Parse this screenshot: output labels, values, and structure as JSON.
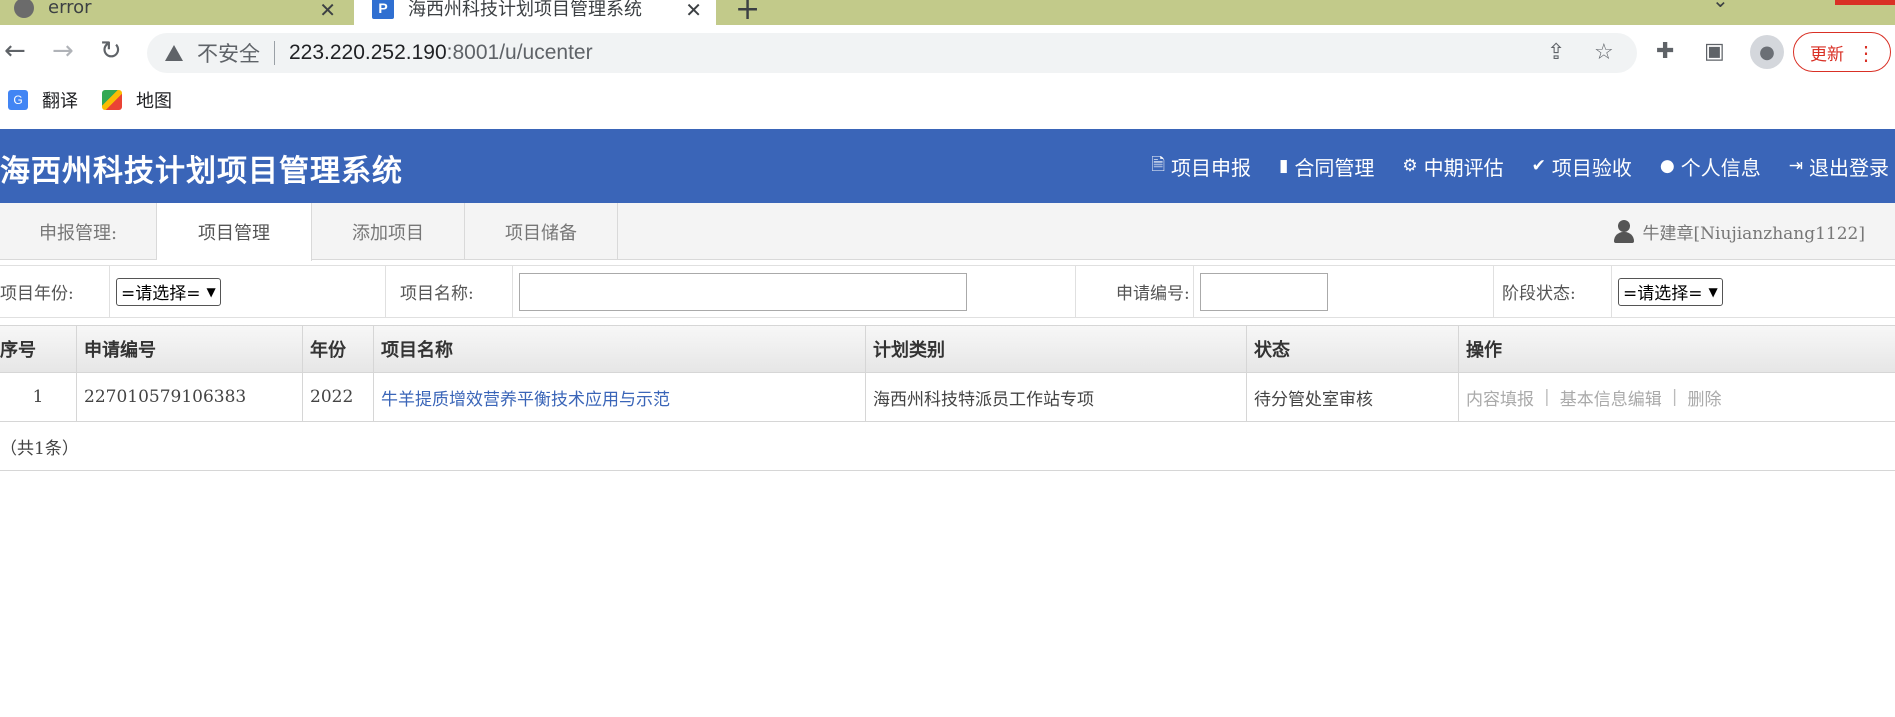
{
  "browser": {
    "tabs": [
      {
        "title": "error",
        "active": false
      },
      {
        "title": "海西州科技计划项目管理系统",
        "active": true
      }
    ],
    "address": {
      "security_label": "不安全",
      "host": "223.220.252.190",
      "path": ":8001/u/ucenter"
    },
    "update_label": "更新",
    "bookmarks": [
      {
        "label": "翻译",
        "icon": "translate-icon"
      },
      {
        "label": "地图",
        "icon": "maps-icon"
      }
    ]
  },
  "app": {
    "title": "海西州科技计划项目管理系统",
    "nav": [
      {
        "label": "项目申报",
        "icon": "word-doc-icon"
      },
      {
        "label": "合同管理",
        "icon": "file-icon"
      },
      {
        "label": "中期评估",
        "icon": "gears-icon"
      },
      {
        "label": "项目验收",
        "icon": "check-circle-icon"
      },
      {
        "label": "个人信息",
        "icon": "user-icon"
      },
      {
        "label": "退出登录",
        "icon": "sign-out-icon"
      }
    ],
    "colors": {
      "header_bg": "#3a65b8",
      "link": "#3a65b8"
    }
  },
  "subnav": {
    "label": "申报管理:",
    "tabs": [
      "项目管理",
      "添加项目",
      "项目储备"
    ],
    "active_tab": "项目管理",
    "user": "牛建章[Niujianzhang1122]"
  },
  "filters": {
    "year_label": "项目年份:",
    "year_value": "=请选择=",
    "name_label": "项目名称:",
    "name_value": "",
    "code_label": "申请编号:",
    "code_value": "",
    "stage_label": "阶段状态:",
    "stage_value": "=请选择="
  },
  "table": {
    "headers": [
      "序号",
      "申请编号",
      "年份",
      "项目名称",
      "计划类别",
      "状态",
      "操作"
    ],
    "rows": [
      {
        "index": "1",
        "code": "227010579106383",
        "year": "2022",
        "name": "牛羊提质增效营养平衡技术应用与示范",
        "category": "海西州科技特派员工作站专项",
        "status": "待分管处室审核",
        "actions": [
          "内容填报",
          "基本信息编辑",
          "删除"
        ]
      }
    ],
    "total": "（共1条）"
  }
}
